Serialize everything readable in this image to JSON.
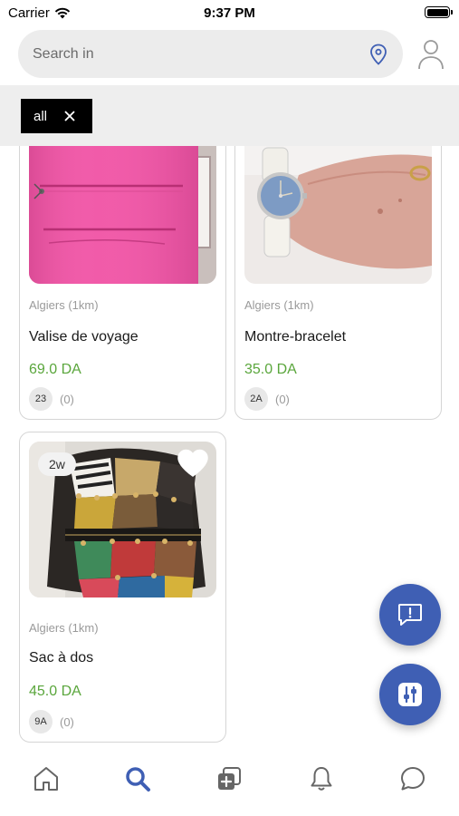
{
  "status_bar": {
    "carrier": "Carrier",
    "time": "9:37 PM"
  },
  "search": {
    "placeholder": "Search in"
  },
  "filter": {
    "chip_label": "all"
  },
  "listings": [
    {
      "badge": "",
      "location": "Algiers (1km)",
      "title": "Valise de voyage",
      "price": "69.0 DA",
      "seller_badge": "23",
      "reviews": "(0)"
    },
    {
      "badge": "",
      "location": "Algiers (1km)",
      "title": "Montre-bracelet",
      "price": "35.0 DA",
      "seller_badge": "2A",
      "reviews": "(0)"
    },
    {
      "badge": "2w",
      "location": "Algiers (1km)",
      "title": "Sac à dos",
      "price": "45.0 DA",
      "seller_badge": "9A",
      "reviews": "(0)"
    }
  ],
  "colors": {
    "accent": "#3f5fb4",
    "price": "#5aa63c",
    "chip": "#000000"
  },
  "icons": {
    "search_location": "location-pin-icon",
    "profile": "user-icon",
    "favorite": "heart-icon",
    "fab_feedback": "message-alert-icon",
    "fab_filters": "sliders-icon",
    "nav": [
      "home-icon",
      "search-icon",
      "add-post-icon",
      "bell-icon",
      "chat-icon"
    ]
  },
  "bottom_nav": {
    "active": "search"
  }
}
